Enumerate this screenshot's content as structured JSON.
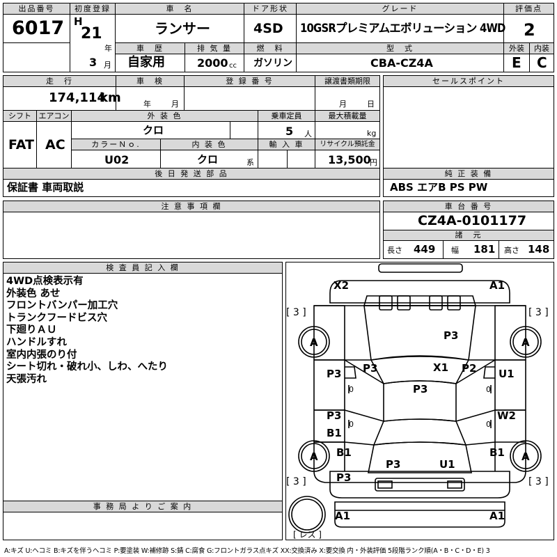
{
  "header": {
    "lot_label": "出品番号",
    "lot": "6017",
    "first_reg_label": "初度登録",
    "era": "H",
    "year": "21",
    "year_unit": "年",
    "month": "3",
    "month_unit": "月",
    "name_label": "車　名",
    "name": "ランサー",
    "doors_label": "ドア形状",
    "doors": "4SD",
    "grade_label": "グレード",
    "grade": "10GSRプレミアムエボリューション 4WD",
    "score_label": "評価点",
    "score": "2",
    "history_label": "車　歴",
    "history": "自家用",
    "displacement_label": "排 気 量",
    "displacement": "2000",
    "displacement_unit": "cc",
    "fuel_label": "燃　料",
    "fuel": "ガソリン",
    "model_label": "型　式",
    "model": "CBA-CZ4A",
    "ext_label": "外装",
    "ext": "E",
    "int_label": "内装",
    "int": "C"
  },
  "info": {
    "mileage_label": "走　行",
    "mileage": "174,114",
    "mileage_unit": "km",
    "inspection_label": "車　検",
    "inspection_year": "年",
    "inspection_month": "月",
    "reg_label": "登 録 番 号",
    "transfer_label": "譲渡書類期限",
    "transfer_month": "月",
    "transfer_day": "日",
    "shift_label": "シフト",
    "shift": "FAT",
    "ac_label": "エアコン",
    "ac": "AC",
    "color_label": "外 装 色",
    "color": "クロ",
    "capacity_label": "乗車定員",
    "capacity": "5",
    "capacity_unit": "人",
    "load_label": "最大積載量",
    "load_unit": "kg",
    "colorno_label": "カラーＮｏ.",
    "colorno": "U02",
    "interior_label": "内 装 色",
    "interior": "クロ",
    "interior_unit": "系",
    "import_label": "輸 入 車",
    "recycle_label": "リサイクル預託金",
    "recycle": "13,500",
    "recycle_unit": "円",
    "docs_label": "後 日 発 送 部 品",
    "docs": "保証書 車両取説"
  },
  "sales": {
    "label": "セールスポイント",
    "equip_label": "純 正 装 備",
    "equip": "ABS エアB PS PW",
    "frame_label": "車 台 番 号",
    "frame": "CZ4A-0101177",
    "spec_label": "諸　元",
    "length_label": "長さ",
    "length": "449",
    "width_label": "幅",
    "width": "181",
    "height_label": "高さ",
    "height": "148"
  },
  "notes": {
    "label": "注 意 事 項 欄"
  },
  "inspector": {
    "label": "検 査 員 記 入 欄",
    "lines": [
      "4WD点検表示有",
      "外装色 あせ",
      "フロントバンパー加工穴",
      "トランクフードビス穴",
      "下廻りＡＵ",
      "ハンドルすれ",
      "室内内張のり付",
      "シート切れ・破れ小、しわ、へたり",
      "天張汚れ"
    ]
  },
  "office": {
    "label": "事 務 局 よ り ご 案 内"
  },
  "diagram": {
    "marks": {
      "x2": "X2",
      "a1_top": "A1",
      "tire_fl": "[ 3 ]",
      "tire_fr": "[ 3 ]",
      "tire_rl": "[ 3 ]",
      "tire_rr": "[ 3 ]",
      "wheel_fl": "A",
      "wheel_fr": "A",
      "wheel_rl": "A",
      "wheel_rr": "A",
      "hood": "P3",
      "fender_l": "P3",
      "x1": "X1",
      "fender_r": "P2",
      "door_fl": "P3",
      "door_fr": "U1",
      "roof": "P3",
      "door_rl_p": "P3",
      "door_rl_b": "B1",
      "door_rr": "W2",
      "quarter_l": "B1",
      "quarter_r": "B1",
      "trunk": "P3",
      "trunk_u": "U1",
      "rear_l": "P3",
      "rear_a_l": "A1",
      "rear_a_r": "A1",
      "spare": "[ レス ]",
      "zero1": "0",
      "zero2": "0",
      "zero3": "0",
      "zero4": "0"
    }
  },
  "legend": "A:キズ U:ヘコミ B:キズを伴うヘコミ P:要塗装 W:補修跡 S:錆 C:腐食 G:フロントガラス点キズ XX:交換済み X:要交換 内・外装評価 5段階ランク順(A・B・C・D・E) 3"
}
